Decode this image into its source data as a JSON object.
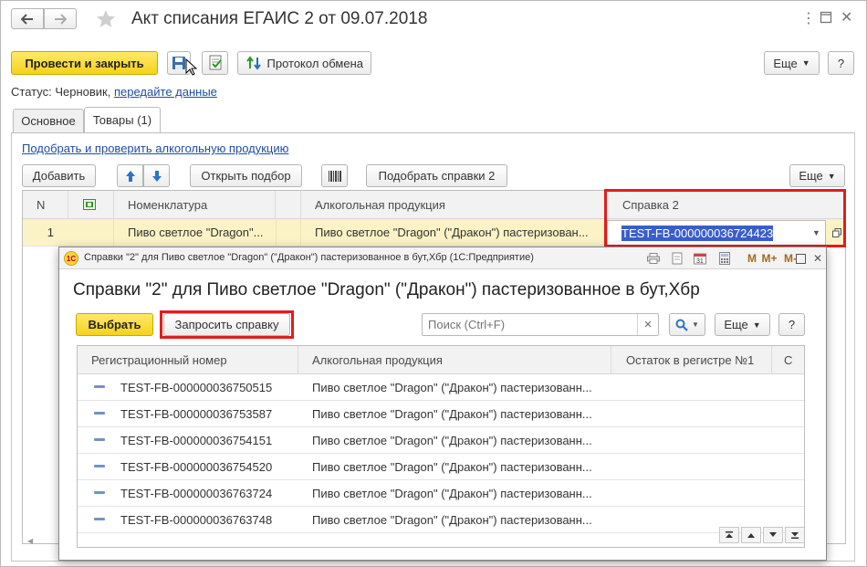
{
  "window": {
    "title": "Акт списания ЕГАИС 2 от 09.07.2018"
  },
  "toolbar": {
    "post_close_label": "Провести и закрыть",
    "exchange_protocol_label": "Протокол обмена",
    "more_label": "Еще",
    "help_label": "?"
  },
  "status": {
    "label": "Статус:",
    "value": "Черновик,",
    "link": "передайте данные"
  },
  "tabs": [
    {
      "label": "Основное",
      "active": false
    },
    {
      "label": "Товары (1)",
      "active": true
    }
  ],
  "goods": {
    "pick_link": "Подобрать и проверить алкогольную продукцию",
    "add_label": "Добавить",
    "open_pick_label": "Открыть подбор",
    "pick_certs_label": "Подобрать справки 2",
    "more_label": "Еще",
    "columns": [
      "N",
      "",
      "Номенклатура",
      "",
      "Алкогольная продукция",
      "Справка 2"
    ],
    "rows": [
      {
        "n": "1",
        "nomenclature": "Пиво светлое \"Dragon\"...",
        "product": "Пиво светлое \"Dragon\" (\"Дракон\") пастеризован...",
        "cert": "TEST-FB-000000036724423"
      }
    ]
  },
  "dialog": {
    "title": "Справки \"2\" для Пиво светлое \"Dragon\" (\"Дракон\") пастеризованное в бут,Хбр  (1С:Предприятие)",
    "app_icon": "1С",
    "heading": "Справки \"2\" для Пиво светлое \"Dragon\" (\"Дракон\") пастеризованное в бут,Хбр",
    "select_label": "Выбрать",
    "request_label": "Запросить справку",
    "search_placeholder": "Поиск (Ctrl+F)",
    "more_label": "Еще",
    "help_label": "?",
    "title_buttons": [
      "M",
      "M+",
      "M-"
    ],
    "columns": [
      "Регистрационный номер",
      "Алкогольная продукция",
      "Остаток в регистре №1",
      "С"
    ],
    "rows": [
      {
        "reg": "TEST-FB-000000036750515",
        "product": "Пиво светлое \"Dragon\" (\"Дракон\") пастеризованн..."
      },
      {
        "reg": "TEST-FB-000000036753587",
        "product": "Пиво светлое \"Dragon\" (\"Дракон\") пастеризованн..."
      },
      {
        "reg": "TEST-FB-000000036754151",
        "product": "Пиво светлое \"Dragon\" (\"Дракон\") пастеризованн..."
      },
      {
        "reg": "TEST-FB-000000036754520",
        "product": "Пиво светлое \"Dragon\" (\"Дракон\") пастеризованн..."
      },
      {
        "reg": "TEST-FB-000000036763724",
        "product": "Пиво светлое \"Dragon\" (\"Дракон\") пастеризованн..."
      },
      {
        "reg": "TEST-FB-000000036763748",
        "product": "Пиво светлое \"Dragon\" (\"Дракон\") пастеризованн..."
      }
    ]
  },
  "colors": {
    "accent_yellow": "#f5d21a",
    "highlight_row": "#fbf3c5",
    "selection_blue": "#3a5ec8",
    "annotation_red": "#e11c1c",
    "link_blue": "#1e4ea3"
  }
}
